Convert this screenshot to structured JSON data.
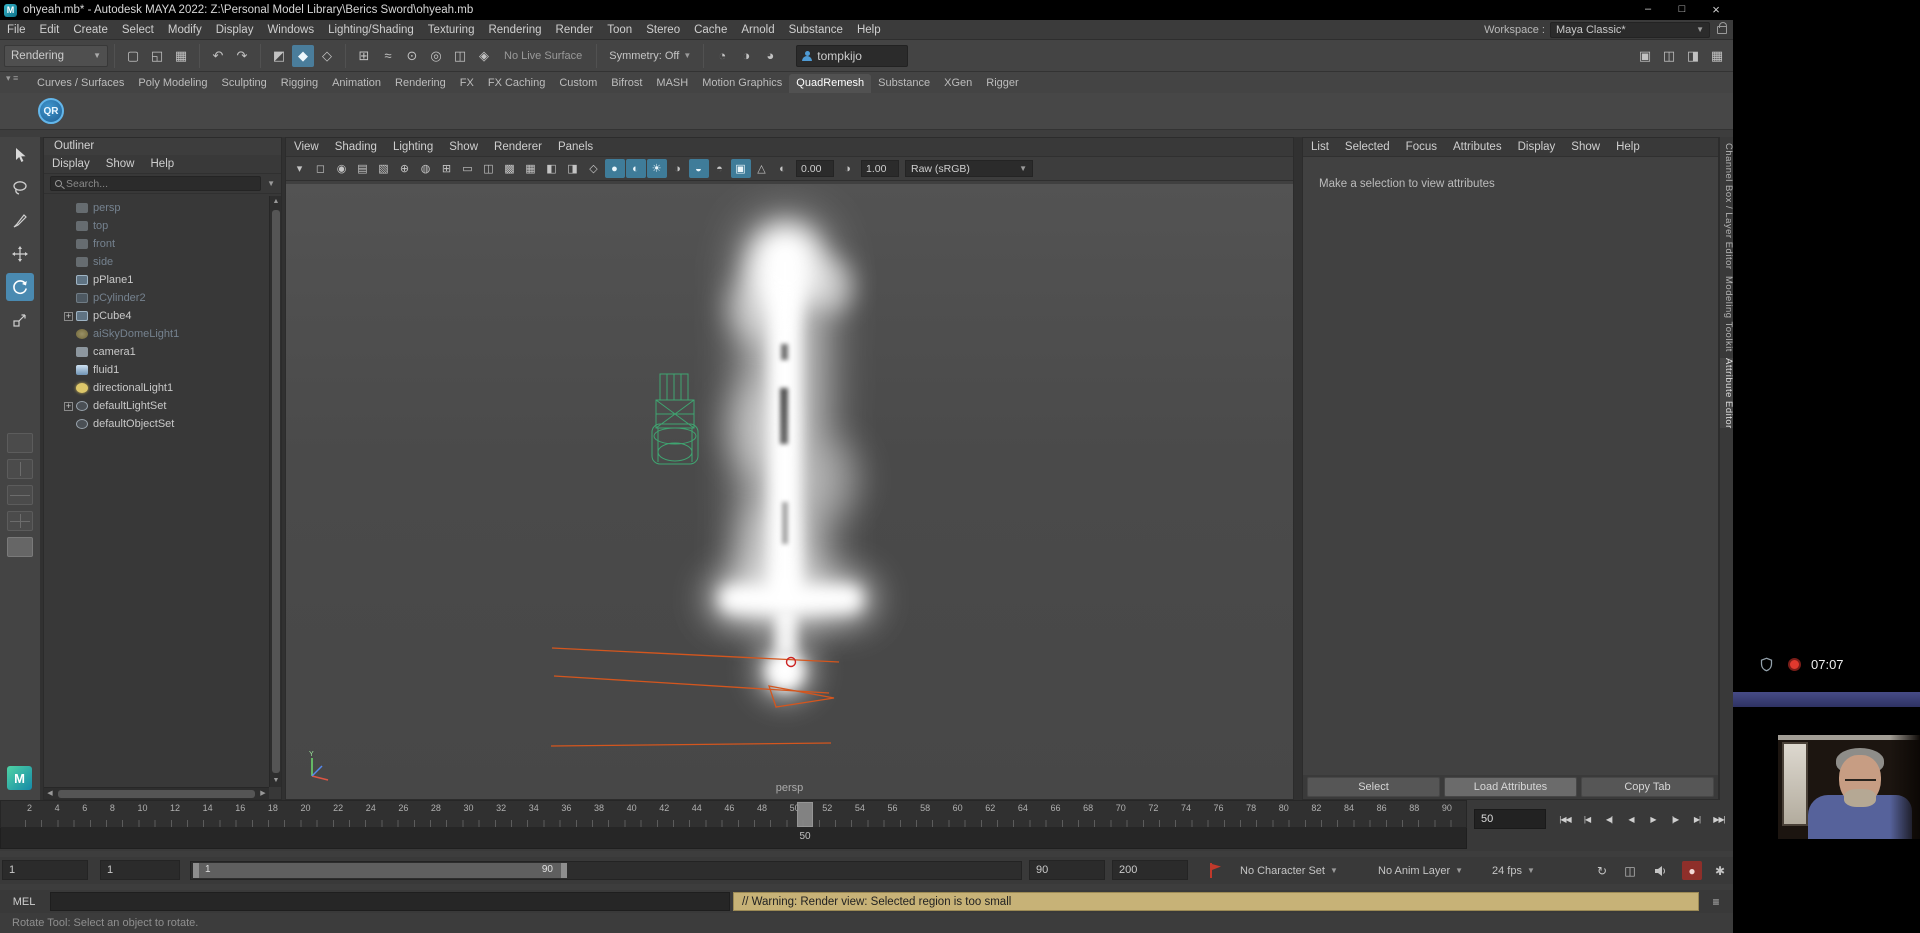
{
  "window": {
    "title": "ohyeah.mb* - Autodesk MAYA 2022: Z:\\Personal Model Library\\Berics Sword\\ohyeah.mb",
    "controls": [
      {
        "name": "minimize-button",
        "glyph": "–"
      },
      {
        "name": "maximize-button",
        "glyph": "□"
      },
      {
        "name": "close-button",
        "glyph": "×"
      }
    ],
    "workspace_label": "Workspace :",
    "workspace_value": "Maya Classic*"
  },
  "menubar": [
    "File",
    "Edit",
    "Create",
    "Select",
    "Modify",
    "Display",
    "Windows",
    "Lighting/Shading",
    "Texturing",
    "Rendering",
    "Render",
    "Toon",
    "Stereo",
    "Cache",
    "Arnold",
    "Substance",
    "Help"
  ],
  "toolbar": {
    "menuset": "Rendering",
    "file_icons": [
      {
        "name": "new-scene-icon",
        "glyph": "▢"
      },
      {
        "name": "open-scene-icon",
        "glyph": "◱"
      },
      {
        "name": "save-scene-icon",
        "glyph": "▦"
      }
    ],
    "history_icons": [
      {
        "name": "undo-icon",
        "glyph": "↶"
      },
      {
        "name": "redo-icon",
        "glyph": "↷"
      }
    ],
    "mask_icons": [
      {
        "name": "select-hierarchy-icon",
        "glyph": "◩"
      },
      {
        "name": "select-object-icon",
        "glyph": "◆",
        "active": true
      },
      {
        "name": "select-component-icon",
        "glyph": "◇"
      }
    ],
    "snap_icons": [
      {
        "name": "snap-grid-icon",
        "glyph": "⊞"
      },
      {
        "name": "snap-curve-icon",
        "glyph": "≈"
      },
      {
        "name": "snap-point-icon",
        "glyph": "⊙"
      },
      {
        "name": "snap-center-icon",
        "glyph": "◎"
      },
      {
        "name": "snap-plane-icon",
        "glyph": "◫"
      },
      {
        "name": "make-live-icon",
        "glyph": "◈"
      }
    ],
    "live_surface_label": "No Live Surface",
    "symmetry_label": "Symmetry: Off",
    "render_icons": [
      {
        "name": "render-frame-icon",
        "glyph": "◔"
      },
      {
        "name": "ipr-render-icon",
        "glyph": "◑"
      },
      {
        "name": "render-settings-icon",
        "glyph": "◕"
      }
    ],
    "user_field": "tompkijo",
    "right_icons": [
      {
        "name": "single-pane-layout-icon",
        "glyph": "▣"
      },
      {
        "name": "toolbox-toggle-icon",
        "glyph": "◫"
      },
      {
        "name": "channel-box-toggle-icon",
        "glyph": "◨"
      },
      {
        "name": "panel-layout-icon",
        "glyph": "▦"
      }
    ]
  },
  "shelf": {
    "tabs": [
      {
        "label": "Curves / Surfaces"
      },
      {
        "label": "Poly Modeling"
      },
      {
        "label": "Sculpting"
      },
      {
        "label": "Rigging"
      },
      {
        "label": "Animation"
      },
      {
        "label": "Rendering"
      },
      {
        "label": "FX"
      },
      {
        "label": "FX Caching"
      },
      {
        "label": "Custom"
      },
      {
        "label": "Bifrost"
      },
      {
        "label": "MASH"
      },
      {
        "label": "Motion Graphics"
      },
      {
        "label": "QuadRemesh",
        "active": true
      },
      {
        "label": "Substance"
      },
      {
        "label": "XGen"
      },
      {
        "label": "Rigger"
      }
    ],
    "qr_button_label": "QR"
  },
  "outliner": {
    "title": "Outliner",
    "menus": [
      "Display",
      "Show",
      "Help"
    ],
    "search_placeholder": "Search...",
    "items": [
      {
        "label": "persp",
        "icon": "camera",
        "dimmed": true
      },
      {
        "label": "top",
        "icon": "camera",
        "dimmed": true
      },
      {
        "label": "front",
        "icon": "camera",
        "dimmed": true
      },
      {
        "label": "side",
        "icon": "camera",
        "dimmed": true
      },
      {
        "label": "pPlane1",
        "icon": "mesh"
      },
      {
        "label": "pCylinder2",
        "icon": "mesh",
        "dimmed": true
      },
      {
        "label": "pCube4",
        "icon": "mesh",
        "expandable": true
      },
      {
        "label": "aiSkyDomeLight1",
        "icon": "skydome",
        "dimmed": true
      },
      {
        "label": "camera1",
        "icon": "camera"
      },
      {
        "label": "fluid1",
        "icon": "fluid"
      },
      {
        "label": "directionalLight1",
        "icon": "light"
      },
      {
        "label": "defaultLightSet",
        "icon": "set",
        "expandable": true
      },
      {
        "label": "defaultObjectSet",
        "icon": "set"
      }
    ]
  },
  "viewport": {
    "menus": [
      "View",
      "Shading",
      "Lighting",
      "Show",
      "Renderer",
      "Panels"
    ],
    "icons": [
      {
        "name": "select-camera-icon",
        "glyph": "▾"
      },
      {
        "name": "lock-camera-icon",
        "glyph": "◻"
      },
      {
        "name": "camera-attributes-icon",
        "glyph": "◉"
      },
      {
        "name": "bookmark-icon",
        "glyph": "▤"
      },
      {
        "name": "image-plane-icon",
        "glyph": "▧"
      },
      {
        "name": "2d-pan-zoom-icon",
        "glyph": "⊕"
      },
      {
        "name": "joint-xray-icon",
        "glyph": "◍"
      },
      {
        "name": "grid-icon",
        "glyph": "⊞"
      },
      {
        "name": "film-gate-icon",
        "glyph": "▭"
      },
      {
        "name": "resolution-gate-icon",
        "glyph": "◫"
      },
      {
        "name": "gate-mask-icon",
        "glyph": "▩"
      },
      {
        "name": "field-chart-icon",
        "glyph": "▦"
      },
      {
        "name": "safe-action-icon",
        "glyph": "◧"
      },
      {
        "name": "safe-title-icon",
        "glyph": "◨"
      },
      {
        "name": "wireframe-icon",
        "glyph": "◇"
      },
      {
        "name": "smooth-shade-icon",
        "glyph": "●",
        "active": true
      },
      {
        "name": "textured-icon",
        "glyph": "◐",
        "active": true
      },
      {
        "name": "use-all-lights-icon",
        "glyph": "☀",
        "active": true
      },
      {
        "name": "shadows-icon",
        "glyph": "◑"
      },
      {
        "name": "screen-ao-icon",
        "glyph": "◒",
        "active": true
      },
      {
        "name": "motion-blur-icon",
        "glyph": "◓"
      },
      {
        "name": "multisample-icon",
        "glyph": "▣",
        "active": true
      },
      {
        "name": "xray-icon",
        "glyph": "△"
      }
    ],
    "exposure_value": "0.00",
    "gamma_value": "1.00",
    "colorspace_value": "Raw (sRGB)",
    "camera_label": "persp"
  },
  "attribute_editor": {
    "menus": [
      "List",
      "Selected",
      "Focus",
      "Attributes",
      "Display",
      "Show",
      "Help"
    ],
    "empty_message": "Make a selection to view attributes",
    "buttons": [
      {
        "label": "Select",
        "name": "select-button"
      },
      {
        "label": "Load Attributes",
        "name": "load-attributes-button",
        "active": true
      },
      {
        "label": "Copy Tab",
        "name": "copy-tab-button"
      }
    ]
  },
  "right_tabs": [
    {
      "label": "Channel Box / Layer Editor",
      "name": "tab-channel-box"
    },
    {
      "label": "Modeling Toolkit",
      "name": "tab-modeling-toolkit"
    },
    {
      "label": "Attribute Editor",
      "name": "tab-attribute-editor",
      "active": true
    }
  ],
  "timeline": {
    "tick_labels": [
      "2",
      "4",
      "6",
      "8",
      "10",
      "12",
      "14",
      "16",
      "18",
      "20",
      "22",
      "24",
      "26",
      "28",
      "30",
      "32",
      "34",
      "36",
      "38",
      "40",
      "42",
      "44",
      "46",
      "48",
      "50",
      "52",
      "54",
      "56",
      "58",
      "60",
      "62",
      "64",
      "66",
      "68",
      "70",
      "72",
      "74",
      "76",
      "78",
      "80",
      "82",
      "84",
      "86",
      "88",
      "90"
    ],
    "current_frame_label": "50",
    "current_frame_field": "50",
    "transport": [
      {
        "name": "go-to-start-button",
        "glyph": "|◀◀"
      },
      {
        "name": "step-back-frame-button",
        "glyph": "|◀"
      },
      {
        "name": "step-back-key-button",
        "glyph": "◀|"
      },
      {
        "name": "play-backwards-button",
        "glyph": "◀"
      },
      {
        "name": "play-forwards-button",
        "glyph": "▶"
      },
      {
        "name": "step-forward-key-button",
        "glyph": "|▶"
      },
      {
        "name": "step-forward-frame-button",
        "glyph": "▶|"
      },
      {
        "name": "go-to-end-button",
        "glyph": "▶▶|"
      }
    ]
  },
  "range_slider": {
    "animation_start": "1",
    "playback_start": "1",
    "range_start_label": "1",
    "range_end_label": "90",
    "playback_end": "90",
    "animation_end": "200",
    "character_set": "No Character Set",
    "anim_layer": "No Anim Layer",
    "fps": "24 fps"
  },
  "command_line": {
    "mel_label": "MEL",
    "input_value": "",
    "warning": "// Warning: Render view: Selected region is too small"
  },
  "help_line": "Rotate Tool: Select an object to rotate.",
  "recorder": {
    "time": "07:07"
  },
  "colors": {
    "accent_teal": "#4a8ab1",
    "warning_bg": "#c7b277",
    "record_red": "#e0392e"
  }
}
